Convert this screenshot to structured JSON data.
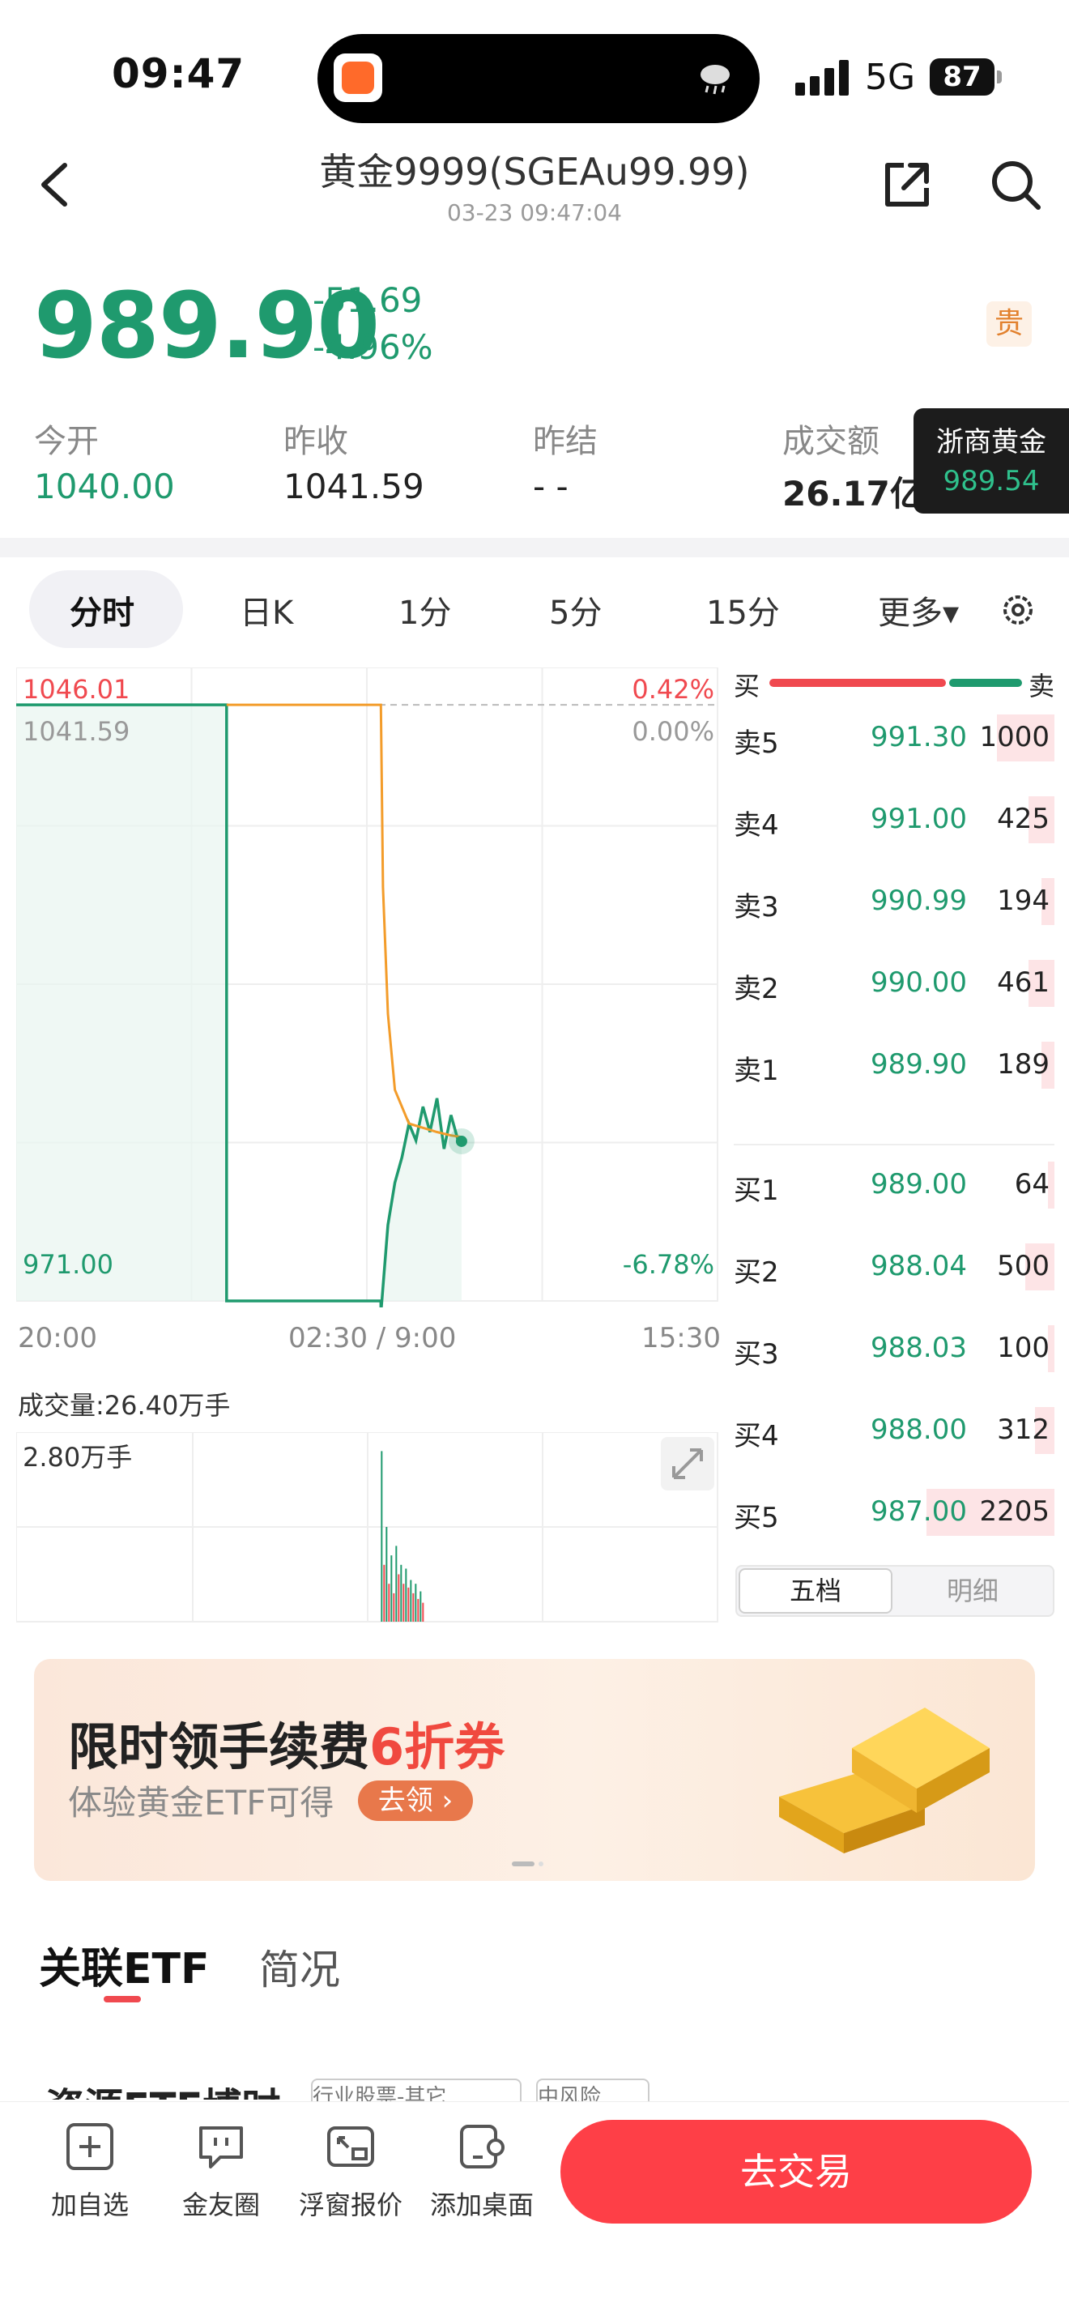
{
  "status_bar": {
    "time": "09:47",
    "network": "5G",
    "battery": "87"
  },
  "header": {
    "title": "黄金9999(SGEAu99.99)",
    "subtitle": "03-23 09:47:04"
  },
  "quote": {
    "price": "989.90",
    "change": "-51.69",
    "change_pct": "-4.96%",
    "badge": "贵",
    "stats": {
      "open_label": "今开",
      "open_value": "1040.00",
      "prev_close_label": "昨收",
      "prev_close_value": "1041.59",
      "prev_settle_label": "昨结",
      "prev_settle_value": "- -",
      "amount_label": "成交额",
      "amount_value": "26.17亿"
    },
    "zs_card": {
      "name": "浙商黄金",
      "price": "989.54"
    }
  },
  "tabs": [
    "分时",
    "日K",
    "1分",
    "5分",
    "15分",
    "更多▾"
  ],
  "chart_data": {
    "type": "line",
    "y_top_label": "1046.01",
    "y_ref_label": "1041.59",
    "y_bottom_label": "971.00",
    "pct_top": "0.42%",
    "pct_ref": "0.00%",
    "pct_bottom": "-6.78%",
    "ylim": [
      971.0,
      1046.01
    ],
    "x_ticks": [
      "20:00",
      "02:30 / 9:00",
      "15:30"
    ],
    "series": [
      {
        "name": "price",
        "color": "#1f9a6e",
        "x": [
          0,
          0.3,
          0.3,
          0.52,
          0.52,
          0.53,
          0.54,
          0.55,
          0.56,
          0.57,
          0.58,
          0.59,
          0.6,
          0.61,
          0.62,
          0.63,
          0.635
        ],
        "values": [
          1041.59,
          1041.59,
          971.0,
          971.0,
          969.5,
          980,
          985,
          988,
          992,
          990,
          994,
          991,
          995,
          989,
          993,
          990,
          989.9
        ]
      },
      {
        "name": "avg",
        "color": "#f39c2a",
        "x": [
          0.3,
          0.52,
          0.523,
          0.53,
          0.54,
          0.56,
          0.58,
          0.6,
          0.62,
          0.635
        ],
        "values": [
          1041.59,
          1041.59,
          1020,
          1005,
          996,
          992,
          991.5,
          991,
          990.6,
          990.4
        ]
      }
    ],
    "volume_label": "成交量:26.40万手",
    "volume_max_label": "2.80万手"
  },
  "order_book": {
    "head_left": "买",
    "head_right": "卖",
    "asks": [
      {
        "name": "卖5",
        "price": "991.30",
        "vol": "1000",
        "level": 0.18
      },
      {
        "name": "卖4",
        "price": "991.00",
        "vol": "425",
        "level": 0.08
      },
      {
        "name": "卖3",
        "price": "990.99",
        "vol": "194",
        "level": 0.04
      },
      {
        "name": "卖2",
        "price": "990.00",
        "vol": "461",
        "level": 0.08
      },
      {
        "name": "卖1",
        "price": "989.90",
        "vol": "189",
        "level": 0.04
      }
    ],
    "bids": [
      {
        "name": "买1",
        "price": "989.00",
        "vol": "64",
        "level": 0.02
      },
      {
        "name": "买2",
        "price": "988.04",
        "vol": "500",
        "level": 0.09
      },
      {
        "name": "买3",
        "price": "988.03",
        "vol": "100",
        "level": 0.02
      },
      {
        "name": "买4",
        "price": "988.00",
        "vol": "312",
        "level": 0.06
      },
      {
        "name": "买5",
        "price": "987.00",
        "vol": "2205",
        "level": 0.4
      }
    ],
    "tab_a": "五档",
    "tab_b": "明细"
  },
  "banner": {
    "title_a": "限时领手续费",
    "title_b": "6折券",
    "sub": "体验黄金ETF可得",
    "btn": "去领 ›"
  },
  "section_tabs": {
    "etf": "关联ETF",
    "brief": "简况"
  },
  "peek": {
    "text": "资源ETF博时",
    "tag1": "行业股票-其它",
    "tag2": "中风险"
  },
  "bottom_bar": {
    "items": [
      "加自选",
      "金友圈",
      "浮窗报价",
      "添加桌面"
    ],
    "trade": "去交易"
  }
}
